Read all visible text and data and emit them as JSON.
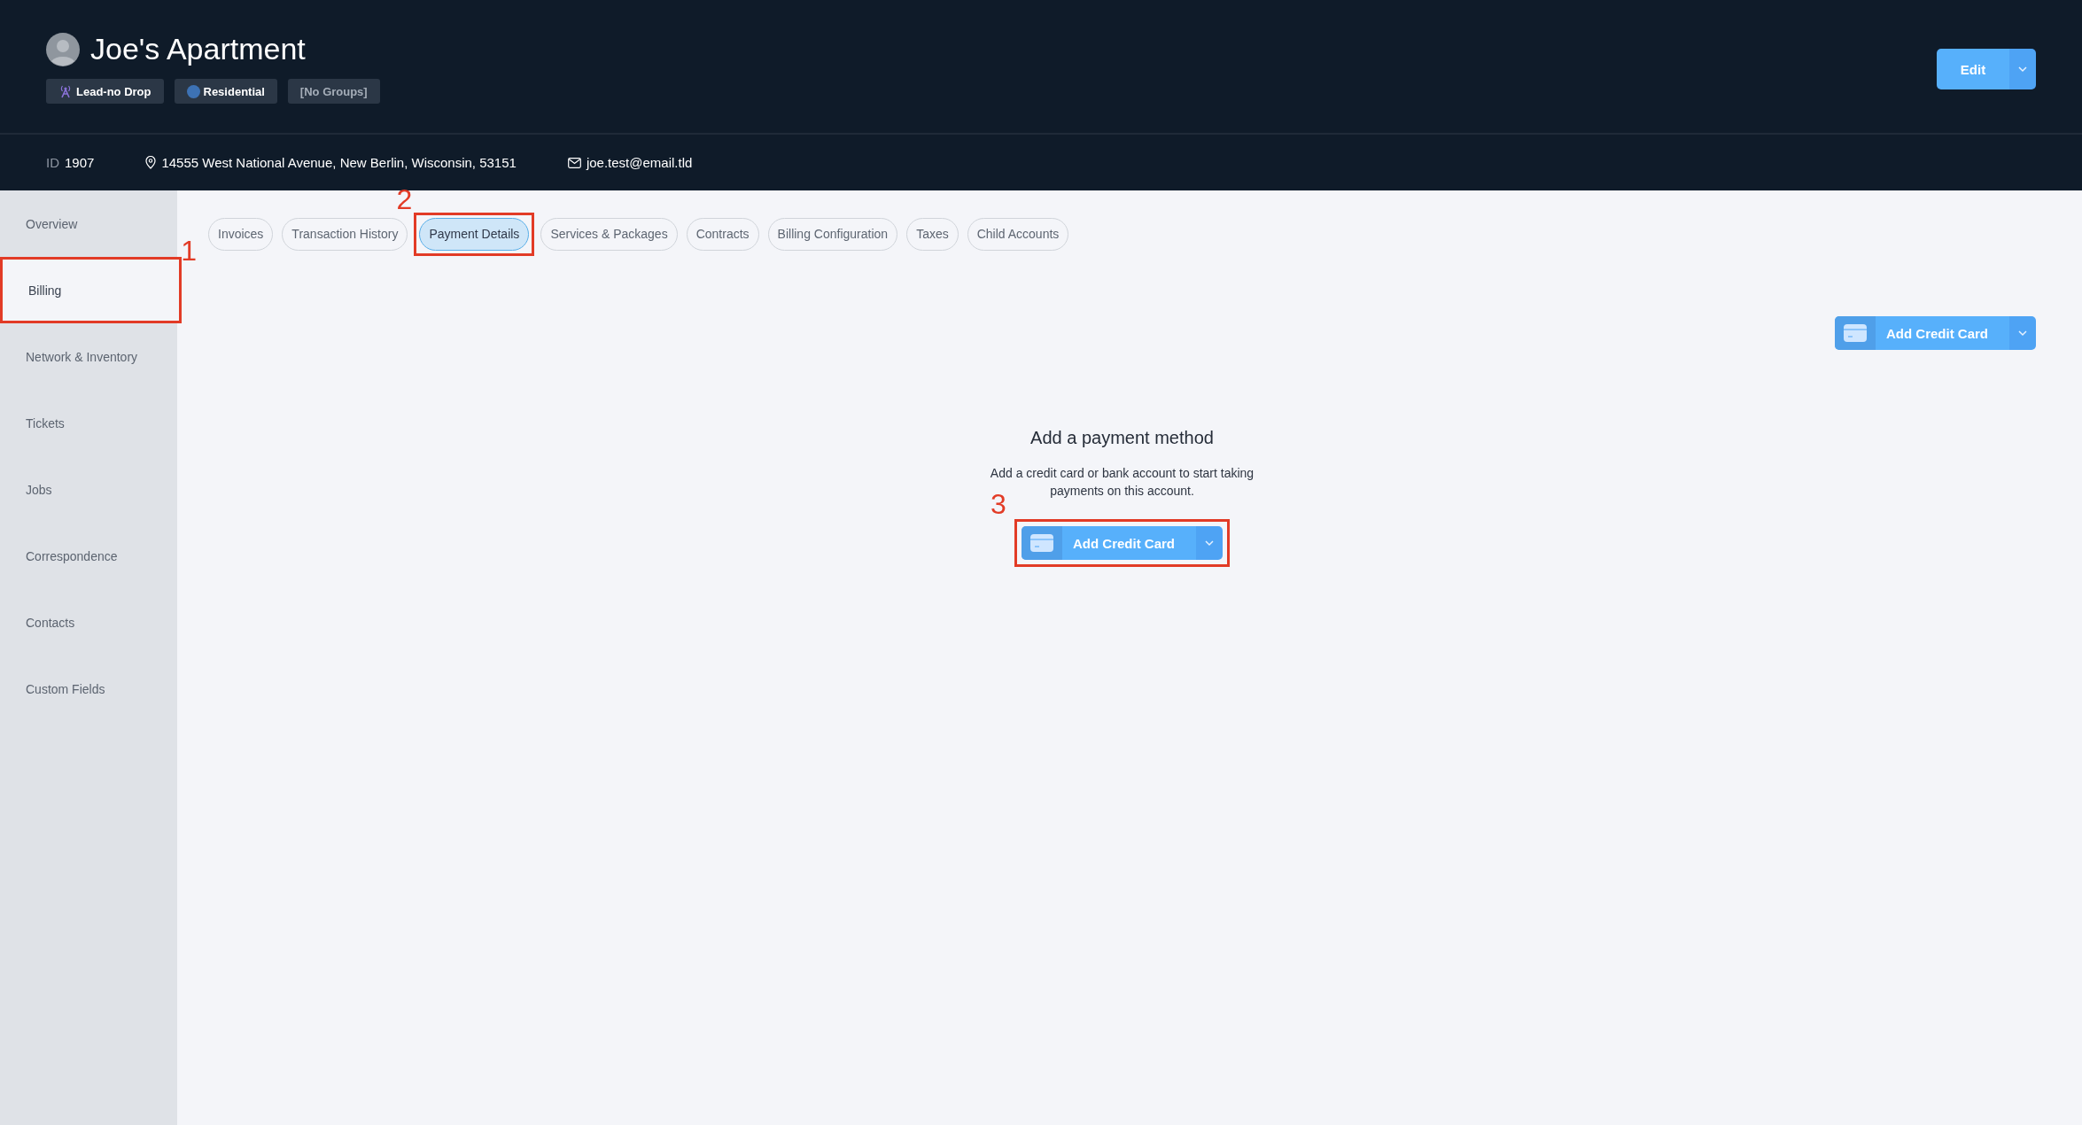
{
  "header": {
    "title": "Joe's Apartment",
    "tags": [
      {
        "label": "Lead-no Drop",
        "kind": "tower"
      },
      {
        "label": "Residential",
        "kind": "dot"
      },
      {
        "label": "[No Groups]",
        "kind": "muted"
      }
    ],
    "edit_button": {
      "label": "Edit"
    }
  },
  "info": {
    "id_label": "ID",
    "id_value": "1907",
    "address": "14555 West National Avenue, New Berlin, Wisconsin, 53151",
    "email": "joe.test@email.tld"
  },
  "sidebar": {
    "items": [
      {
        "label": "Overview",
        "selected": false
      },
      {
        "label": "Billing",
        "selected": true,
        "callout": "1"
      },
      {
        "label": "Network & Inventory",
        "selected": false
      },
      {
        "label": "Tickets",
        "selected": false
      },
      {
        "label": "Jobs",
        "selected": false
      },
      {
        "label": "Correspondence",
        "selected": false
      },
      {
        "label": "Contacts",
        "selected": false
      },
      {
        "label": "Custom Fields",
        "selected": false
      }
    ]
  },
  "tabs": [
    {
      "label": "Invoices",
      "selected": false
    },
    {
      "label": "Transaction History",
      "selected": false
    },
    {
      "label": "Payment Details",
      "selected": true,
      "callout": "2"
    },
    {
      "label": "Services & Packages",
      "selected": false
    },
    {
      "label": "Contracts",
      "selected": false
    },
    {
      "label": "Billing Configuration",
      "selected": false
    },
    {
      "label": "Taxes",
      "selected": false
    },
    {
      "label": "Child Accounts",
      "selected": false
    }
  ],
  "toolbar_button": {
    "label": "Add Credit Card"
  },
  "empty_state": {
    "title": "Add a payment method",
    "description": "Add a credit card or bank account to start taking payments on this account.",
    "button": {
      "label": "Add Credit Card",
      "callout": "3"
    }
  }
}
